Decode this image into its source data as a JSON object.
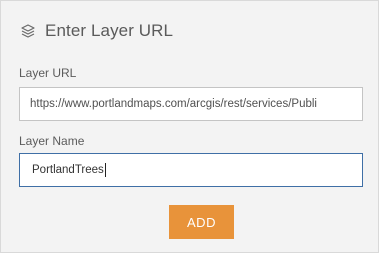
{
  "header": {
    "icon": "layers-icon",
    "title": "Enter Layer URL"
  },
  "form": {
    "url_label": "Layer URL",
    "url_value": "https://www.portlandmaps.com/arcgis/rest/services/Publi",
    "name_label": "Layer Name",
    "name_value": "PortlandTrees"
  },
  "actions": {
    "add_label": "ADD"
  },
  "colors": {
    "panel_bg": "#f3f3f3",
    "accent_button": "#e8933a",
    "focused_border": "#3f6fa6"
  }
}
